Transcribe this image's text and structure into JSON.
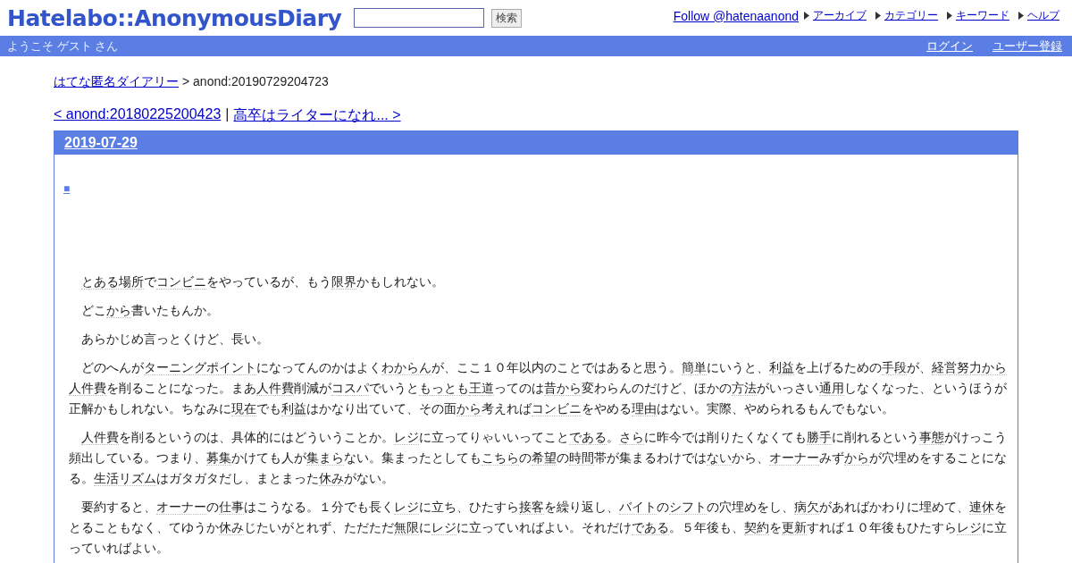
{
  "header": {
    "logo": "Hatelabo::AnonymousDiary",
    "search_button": "検索",
    "follow_link": "Follow @hatenaanond",
    "nav_links": [
      "アーカイブ",
      "カテゴリー",
      "キーワード",
      "ヘルプ"
    ]
  },
  "user_bar": {
    "greeting": "ようこそ ゲスト さん",
    "links": [
      "ログイン",
      "ユーザー登録"
    ]
  },
  "breadcrumb": {
    "link": "はてな匿名ダイアリー",
    "current": "> anond:20190729204723"
  },
  "pager": {
    "prev": "< anond:20180225200423",
    "separator": "|",
    "next": "高卒はライターになれ... >"
  },
  "entry": {
    "date": "2019-07-29",
    "mark": "■",
    "paragraphs": [
      [
        {
          "text": "とある場所",
          "keyword": true
        },
        {
          "text": "で",
          "keyword": false
        },
        {
          "text": "コンビニ",
          "keyword": true
        },
        {
          "text": "をやっているが、もう",
          "keyword": false
        },
        {
          "text": "限界",
          "keyword": true
        },
        {
          "text": "かもしれない。",
          "keyword": false
        }
      ],
      [
        {
          "text": "どこ",
          "keyword": false
        },
        {
          "text": "から",
          "keyword": true
        },
        {
          "text": "書いたもんか。",
          "keyword": false
        }
      ],
      [
        {
          "text": "あらかじめ言っとくけど、長い。",
          "keyword": false
        }
      ],
      [
        {
          "text": "どのへんが",
          "keyword": false
        },
        {
          "text": "ターニングポイント",
          "keyword": true
        },
        {
          "text": "になってんのかはよく",
          "keyword": false
        },
        {
          "text": "わからん",
          "keyword": true
        },
        {
          "text": "が、ここ１０年以内のことではあると思う。",
          "keyword": false
        },
        {
          "text": "簡単",
          "keyword": true
        },
        {
          "text": "にいうと、",
          "keyword": false
        },
        {
          "text": "利益",
          "keyword": true
        },
        {
          "text": "を上げるための",
          "keyword": false
        },
        {
          "text": "手段",
          "keyword": true
        },
        {
          "text": "が、",
          "keyword": false
        },
        {
          "text": "経営努力から",
          "keyword": true
        },
        {
          "text": "人件費",
          "keyword": true
        },
        {
          "text": "を削ることになった。まあ",
          "keyword": false
        },
        {
          "text": "人件費",
          "keyword": true
        },
        {
          "text": "削減が",
          "keyword": false
        },
        {
          "text": "コスパ",
          "keyword": true
        },
        {
          "text": "でいうと",
          "keyword": false
        },
        {
          "text": "もっとも",
          "keyword": true
        },
        {
          "text": "王道",
          "keyword": true
        },
        {
          "text": "ってのは",
          "keyword": false
        },
        {
          "text": "昔から",
          "keyword": true
        },
        {
          "text": "変わらんのだけど、ほかの",
          "keyword": false
        },
        {
          "text": "方法",
          "keyword": true
        },
        {
          "text": "がいっさい",
          "keyword": false
        },
        {
          "text": "通用",
          "keyword": true
        },
        {
          "text": "しなくなった、というほうが正解かもしれない。ちなみに",
          "keyword": false
        },
        {
          "text": "現在",
          "keyword": true
        },
        {
          "text": "でも",
          "keyword": false
        },
        {
          "text": "利益",
          "keyword": true
        },
        {
          "text": "はかなり出ていて、その面",
          "keyword": false
        },
        {
          "text": "から",
          "keyword": true
        },
        {
          "text": "考えれば",
          "keyword": false
        },
        {
          "text": "コンビニ",
          "keyword": true
        },
        {
          "text": "をやめる",
          "keyword": false
        },
        {
          "text": "理由",
          "keyword": true
        },
        {
          "text": "はない。実際、やめられるもんでもない。",
          "keyword": false
        }
      ],
      [
        {
          "text": "人件費",
          "keyword": true
        },
        {
          "text": "を削るというのは、具体的にはどういうことか。",
          "keyword": false
        },
        {
          "text": "レジ",
          "keyword": true
        },
        {
          "text": "に立ってりゃいいってこと",
          "keyword": false
        },
        {
          "text": "である",
          "keyword": true
        },
        {
          "text": "。",
          "keyword": false
        },
        {
          "text": "さら",
          "keyword": true
        },
        {
          "text": "に昨今では削りたくなくても",
          "keyword": false
        },
        {
          "text": "勝手",
          "keyword": true
        },
        {
          "text": "に削れるという",
          "keyword": false
        },
        {
          "text": "事態",
          "keyword": true
        },
        {
          "text": "がけっこう頻出している。つまり、",
          "keyword": false
        },
        {
          "text": "募集",
          "keyword": true
        },
        {
          "text": "かけても人が",
          "keyword": false
        },
        {
          "text": "集まら",
          "keyword": true
        },
        {
          "text": "ない。集まったとしても",
          "keyword": false
        },
        {
          "text": "こちら",
          "keyword": true
        },
        {
          "text": "の",
          "keyword": false
        },
        {
          "text": "希望",
          "keyword": true
        },
        {
          "text": "の",
          "keyword": false
        },
        {
          "text": "時間",
          "keyword": true
        },
        {
          "text": "帯が集まるわけでは",
          "keyword": false
        },
        {
          "text": "ない",
          "keyword": true
        },
        {
          "text": "から、",
          "keyword": false
        },
        {
          "text": "オーナー",
          "keyword": true
        },
        {
          "text": "みず",
          "keyword": false
        },
        {
          "text": "から",
          "keyword": true
        },
        {
          "text": "が穴埋めをすることになる。",
          "keyword": false
        },
        {
          "text": "生活リズム",
          "keyword": true
        },
        {
          "text": "はガタガタだし、まとまった",
          "keyword": false
        },
        {
          "text": "休み",
          "keyword": true
        },
        {
          "text": "がない。",
          "keyword": false
        }
      ],
      [
        {
          "text": "要約すると、",
          "keyword": false
        },
        {
          "text": "オーナー",
          "keyword": true
        },
        {
          "text": "の",
          "keyword": false
        },
        {
          "text": "仕事",
          "keyword": true
        },
        {
          "text": "はこうなる。１分でも長く",
          "keyword": false
        },
        {
          "text": "レジ",
          "keyword": true
        },
        {
          "text": "に立ち、ひたすら",
          "keyword": false
        },
        {
          "text": "接客",
          "keyword": true
        },
        {
          "text": "を繰り返し、",
          "keyword": false
        },
        {
          "text": "バイト",
          "keyword": true
        },
        {
          "text": "の",
          "keyword": false
        },
        {
          "text": "シフト",
          "keyword": true
        },
        {
          "text": "の穴埋めをし、",
          "keyword": false
        },
        {
          "text": "病欠",
          "keyword": true
        },
        {
          "text": "があればかわりに埋めて、",
          "keyword": false
        },
        {
          "text": "連休",
          "keyword": true
        },
        {
          "text": "をとることもなく、てゆうか",
          "keyword": false
        },
        {
          "text": "休み",
          "keyword": true
        },
        {
          "text": "じたいがとれず、ただただ",
          "keyword": false
        },
        {
          "text": "無限",
          "keyword": true
        },
        {
          "text": "に",
          "keyword": false
        },
        {
          "text": "レジ",
          "keyword": true
        },
        {
          "text": "に立っていればよい。それだけ",
          "keyword": false
        },
        {
          "text": "である",
          "keyword": true
        },
        {
          "text": "。５年後も、",
          "keyword": false
        },
        {
          "text": "契約",
          "keyword": true
        },
        {
          "text": "を",
          "keyword": false
        },
        {
          "text": "更新",
          "keyword": true
        },
        {
          "text": "すれば１０年後もひたすら",
          "keyword": false
        },
        {
          "text": "レジ",
          "keyword": true
        },
        {
          "text": "に立っていればよい。",
          "keyword": false
        }
      ]
    ]
  }
}
